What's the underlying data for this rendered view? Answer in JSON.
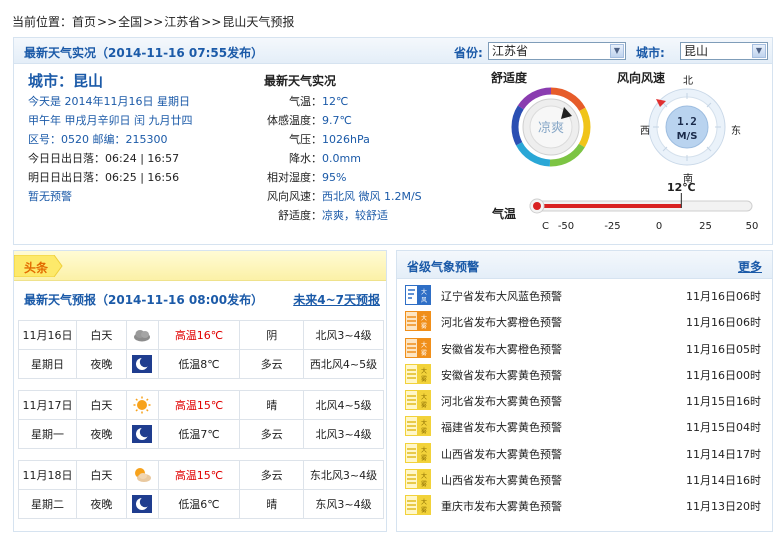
{
  "breadcrumb": {
    "prefix": "当前位置：",
    "items": [
      "首页",
      "全国",
      "江苏省",
      "昆山天气预报"
    ],
    "sep": ">>"
  },
  "realtime": {
    "title": "最新天气实况（2014-11-16  07:55发布）",
    "province_label": "省份:",
    "province_value": "江苏省",
    "city_label": "城市:",
    "city_value": "昆山",
    "city_name": "城市：昆山",
    "today": "今天是 2014年11月16日 星期日",
    "lunar": "甲午年 甲戌月辛卯日 闰 九月廿四",
    "codes": "区号：0520  邮编：215300",
    "today_sun": "今日日出日落：06:24 | 16:57",
    "tomorrow_sun": "明日日出日落：06:25 | 16:56",
    "no_warning": "暂无预警",
    "obs_title": "最新天气实况",
    "obs": [
      {
        "label": "气温：",
        "value": "12℃"
      },
      {
        "label": "体感温度：",
        "value": "9.7℃"
      },
      {
        "label": "气压：",
        "value": "1026hPa"
      },
      {
        "label": "降水：",
        "value": "0.0mm"
      },
      {
        "label": "相对湿度：",
        "value": "95%"
      },
      {
        "label": "风向风速：",
        "value": "西北风 微风 1.2M/S"
      },
      {
        "label": "舒适度：",
        "value": "凉爽，较舒适"
      }
    ],
    "comfort_label": "舒适度",
    "comfort_value": "凉爽",
    "wind_label": "风向风速",
    "wind_speed": "1.2",
    "wind_unit": "M/S",
    "compass": {
      "n": "北",
      "s": "南",
      "e": "东",
      "w": "西"
    },
    "temp_label": "气温",
    "temp_current": "12℃",
    "temp_value": 12,
    "temp_scale": {
      "unit": "C",
      "ticks": [
        "-50",
        "-25",
        "0",
        "25",
        "50"
      ],
      "min": -50,
      "max": 50
    }
  },
  "forecast": {
    "banner": "头条",
    "title": "最新天气预报（2014-11-16  08:00发布）",
    "more": "未来4~7天预报",
    "days": [
      {
        "date": "11月16日",
        "weekday": "星期日",
        "day": {
          "period": "白天",
          "icon": "cloudy-icon",
          "temp": "高温16℃",
          "weather": "阴",
          "wind": "北风3~4级"
        },
        "night": {
          "period": "夜晚",
          "icon": "moon-icon",
          "temp": "低温8℃",
          "weather": "多云",
          "wind": "西北风4~5级"
        }
      },
      {
        "date": "11月17日",
        "weekday": "星期一",
        "day": {
          "period": "白天",
          "icon": "sun-icon",
          "temp": "高温15℃",
          "weather": "晴",
          "wind": "北风4~5级"
        },
        "night": {
          "period": "夜晚",
          "icon": "moon-icon",
          "temp": "低温7℃",
          "weather": "多云",
          "wind": "北风3~4级"
        }
      },
      {
        "date": "11月18日",
        "weekday": "星期二",
        "day": {
          "period": "白天",
          "icon": "sun-cloud-icon",
          "temp": "高温15℃",
          "weather": "多云",
          "wind": "东北风3~4级"
        },
        "night": {
          "period": "夜晚",
          "icon": "moon-icon",
          "temp": "低温6℃",
          "weather": "晴",
          "wind": "东风3~4级"
        }
      }
    ]
  },
  "warnings": {
    "title": "省级气象预警",
    "more": "更多",
    "items": [
      {
        "text": "辽宁省发布大风蓝色预警",
        "time": "11月16日06时",
        "icon": "gale-blue-icon"
      },
      {
        "text": "河北省发布大雾橙色预警",
        "time": "11月16日06时",
        "icon": "fog-orange-icon"
      },
      {
        "text": "安徽省发布大雾橙色预警",
        "time": "11月16日05时",
        "icon": "fog-orange-icon"
      },
      {
        "text": "安徽省发布大雾黄色预警",
        "time": "11月16日00时",
        "icon": "fog-yellow-icon"
      },
      {
        "text": "河北省发布大雾黄色预警",
        "time": "11月15日16时",
        "icon": "fog-yellow-icon"
      },
      {
        "text": "福建省发布大雾黄色预警",
        "time": "11月15日04时",
        "icon": "fog-yellow-icon"
      },
      {
        "text": "山西省发布大雾黄色预警",
        "time": "11月14日17时",
        "icon": "fog-yellow-icon"
      },
      {
        "text": "山西省发布大雾黄色预警",
        "time": "11月14日16时",
        "icon": "fog-yellow-icon"
      },
      {
        "text": "重庆市发布大雾黄色预警",
        "time": "11月13日20时",
        "icon": "fog-yellow-icon"
      }
    ]
  }
}
